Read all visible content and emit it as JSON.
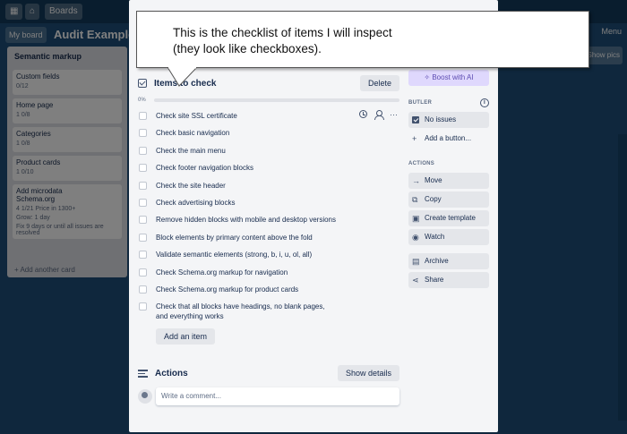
{
  "board": {
    "nav": {
      "boards": "Boards",
      "my_board": "My board",
      "title": "Audit Example",
      "menu": "Menu",
      "side_label": "Show pics"
    },
    "list": {
      "title": "Semantic markup",
      "cards": [
        {
          "title": "Custom fields",
          "meta": "0/12"
        },
        {
          "title": "Home page",
          "meta": "1   0/8"
        },
        {
          "title": "Categories",
          "meta": "1   0/8"
        },
        {
          "title": "Product cards",
          "meta": "1   0/10"
        },
        {
          "title": "Add microdata\nSchema.org",
          "meta": "4   1/21   Price in 1300+"
        }
      ],
      "card_note1": "Grow: 1 day",
      "card_note2": "Fix 9 days or until all issues are resolved",
      "add_card": "+ Add another card"
    }
  },
  "callout": {
    "line1": "This is the checklist of items I will inspect",
    "line2": "(they look like checkboxes)."
  },
  "checklist": {
    "title": "Items to check",
    "delete_label": "Delete",
    "progress_label": "0%",
    "progress_value": 0,
    "items": [
      "Check site SSL certificate",
      "Check basic navigation",
      "Check the main menu",
      "Check footer navigation blocks",
      "Check the site header",
      "Check advertising blocks",
      "Remove hidden blocks with mobile and desktop versions",
      "Block elements by primary content above the fold",
      "Validate semantic elements (strong, b, i, u, ol, all)",
      "Check Schema.org markup for navigation",
      "Check Schema.org markup for product cards",
      "Check that all blocks have headings, no blank pages,",
      "and everything works"
    ],
    "tools_more": "···",
    "add_item_label": "Add an item"
  },
  "activity": {
    "title": "Actions",
    "show_details_label": "Show details",
    "comment_placeholder": "Write a comment..."
  },
  "sidebar": {
    "ai_label": "Boost with AI",
    "butler_label": "BUTLER",
    "no_issues_label": "No issues",
    "add_button_label": "Add a button...",
    "actions_label": "ACTIONS",
    "move_label": "Move",
    "copy_label": "Copy",
    "template_label": "Create template",
    "watch_label": "Watch",
    "archive_label": "Archive",
    "share_label": "Share"
  },
  "colors": {
    "board_bg": "#1e4f7a",
    "progress_fill": "#5aac44",
    "ai_bg": "#dfd8fd"
  }
}
